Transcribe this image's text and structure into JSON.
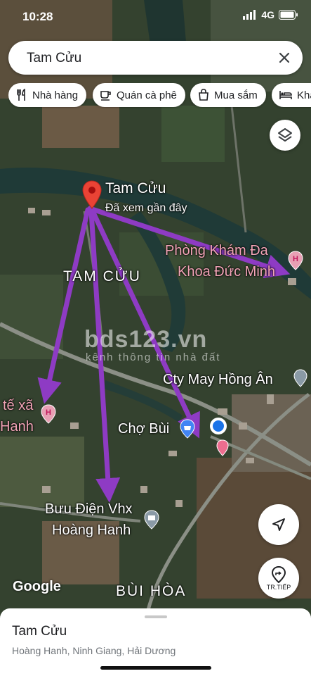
{
  "status_bar": {
    "time": "10:28",
    "network": "4G"
  },
  "search": {
    "value": "Tam Cửu"
  },
  "chips": [
    {
      "label": "Nhà hàng",
      "icon": "restaurant-icon"
    },
    {
      "label": "Quán cà phê",
      "icon": "coffee-icon"
    },
    {
      "label": "Mua sắm",
      "icon": "shopping-bag-icon"
    },
    {
      "label": "Khá",
      "icon": "hotel-icon"
    }
  ],
  "map": {
    "pin": {
      "title": "Tam Cửu",
      "subtitle": "Đã xem gần đây"
    },
    "labels": {
      "area_tam_cuu": "TAM CỬU",
      "clinic_line1": "Phòng Khám Đa",
      "clinic_line2": "Khoa Đức Minh",
      "health_line1": "tế xã",
      "health_line2": "Hanh",
      "company": "Cty May Hồng Ân",
      "market": "Chợ Bùi",
      "post_line1": "Bưu Điện Vhx",
      "post_line2": "Hoàng Hanh",
      "area_bui_hoa": "BÙI HÒA"
    },
    "google_logo": "Google",
    "watermark": {
      "main": "bds123.vn",
      "sub": "kênh thông tin nhà đất"
    },
    "arrow_color": "#8e3bc4"
  },
  "buttons": {
    "directions_label": "TR.TIẾP"
  },
  "sheet": {
    "title": "Tam Cửu",
    "address": "Hoàng Hanh, Ninh Giang, Hải Dương"
  }
}
